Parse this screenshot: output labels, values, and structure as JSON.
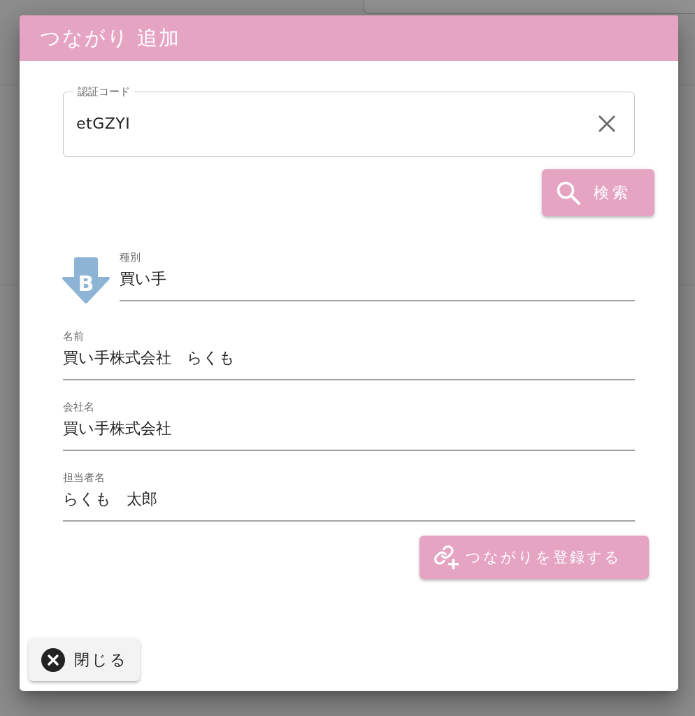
{
  "dialog": {
    "title": "つながり 追加"
  },
  "auth_code_field": {
    "label": "認証コード",
    "value": "etGZYI"
  },
  "search_button": {
    "label": "検索"
  },
  "kind_field": {
    "badge_letter": "B",
    "label": "種別",
    "value": "買い手"
  },
  "fields": [
    {
      "label": "名前",
      "value": "買い手株式会社　らくも"
    },
    {
      "label": "会社名",
      "value": "買い手株式会社"
    },
    {
      "label": "担当者名",
      "value": "らくも　太郎"
    }
  ],
  "register_button": {
    "label": "つながりを登録する"
  },
  "close_button": {
    "label": "閉じる"
  }
}
